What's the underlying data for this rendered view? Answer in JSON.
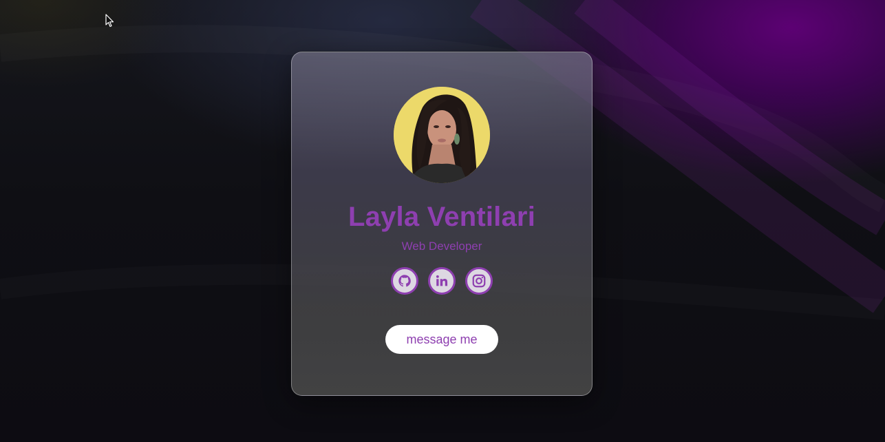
{
  "profile": {
    "name": "Layla Ventilari",
    "role": "Web Developer",
    "avatar_bg": "#ecd96a"
  },
  "socials": [
    {
      "icon": "github-icon"
    },
    {
      "icon": "linkedin-icon"
    },
    {
      "icon": "instagram-icon"
    }
  ],
  "cta": {
    "label": "message me"
  },
  "colors": {
    "accent": "#8e3fb0",
    "button_bg": "#ffffff",
    "icon_bg": "#ddd8e2"
  }
}
